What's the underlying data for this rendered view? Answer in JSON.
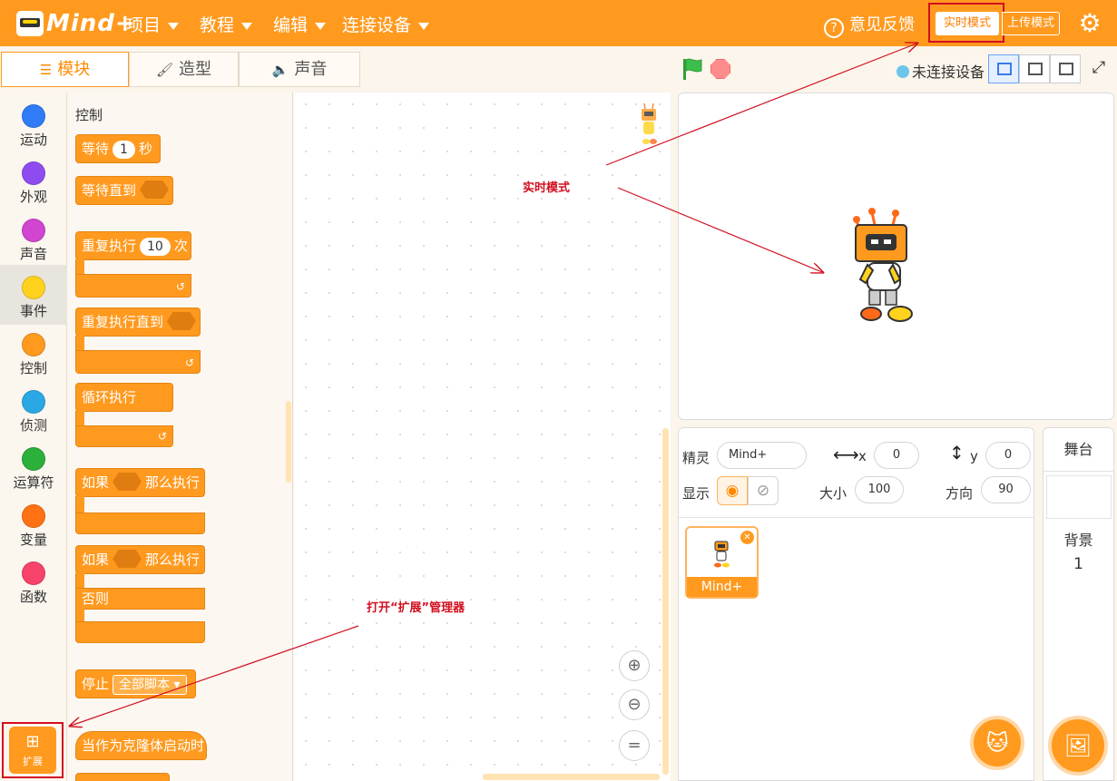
{
  "app": {
    "logo": "Mind+"
  },
  "menu": [
    {
      "label": "项目"
    },
    {
      "label": "教程"
    },
    {
      "label": "编辑"
    },
    {
      "label": "连接设备"
    }
  ],
  "header": {
    "feedback": "意见反馈",
    "mode_realtime": "实时模式",
    "mode_upload": "上传模式",
    "settings_icon": "gear-icon"
  },
  "tabs": [
    {
      "label": "模块",
      "icon": "blocks-icon"
    },
    {
      "label": "造型",
      "icon": "brush-icon"
    },
    {
      "label": "声音",
      "icon": "speaker-icon"
    }
  ],
  "toolbar": {
    "connection_status": "未连接设备",
    "status_color": "#6cc6ec"
  },
  "categories": [
    {
      "label": "运动",
      "color": "#2f7cf6"
    },
    {
      "label": "外观",
      "color": "#8e4cf0"
    },
    {
      "label": "声音",
      "color": "#d145d1"
    },
    {
      "label": "事件",
      "color": "#ffd21e"
    },
    {
      "label": "控制",
      "color": "#ff9a1f"
    },
    {
      "label": "侦测",
      "color": "#2aa8e6"
    },
    {
      "label": "运算符",
      "color": "#2bb03b"
    },
    {
      "label": "变量",
      "color": "#ff7112"
    },
    {
      "label": "函数",
      "color": "#f7436a"
    }
  ],
  "extension": {
    "label": "扩展"
  },
  "palette": {
    "title": "控制",
    "blocks": {
      "wait": {
        "pre": "等待",
        "value": "1",
        "post": "秒"
      },
      "wait_until": "等待直到",
      "repeat": {
        "pre": "重复执行",
        "value": "10",
        "post": "次"
      },
      "repeat_until": "重复执行直到",
      "forever": "循环执行",
      "if_then": {
        "pre": "如果",
        "post": "那么执行"
      },
      "if_else": {
        "pre": "如果",
        "post": "那么执行",
        "else": "否则"
      },
      "stop": {
        "pre": "停止",
        "option": "全部脚本"
      },
      "clone_start": "当作为克隆体启动时"
    }
  },
  "zoom": {
    "in": "zoom-in-icon",
    "out": "zoom-out-icon",
    "reset": "="
  },
  "sprite_info": {
    "sprite_label": "精灵",
    "sprite_name": "Mind+",
    "x_label": "x",
    "x_value": "0",
    "y_label": "y",
    "y_value": "0",
    "show_label": "显示",
    "size_label": "大小",
    "size_value": "100",
    "direction_label": "方向",
    "direction_value": "90"
  },
  "sprite_list": [
    {
      "name": "Mind+"
    }
  ],
  "stage_panel": {
    "title": "舞台",
    "backdrop_label": "背景",
    "backdrop_count": "1"
  },
  "annotations": {
    "realtime": "实时模式",
    "extension": "打开“扩展”管理器",
    "color": "#d10f1f"
  }
}
